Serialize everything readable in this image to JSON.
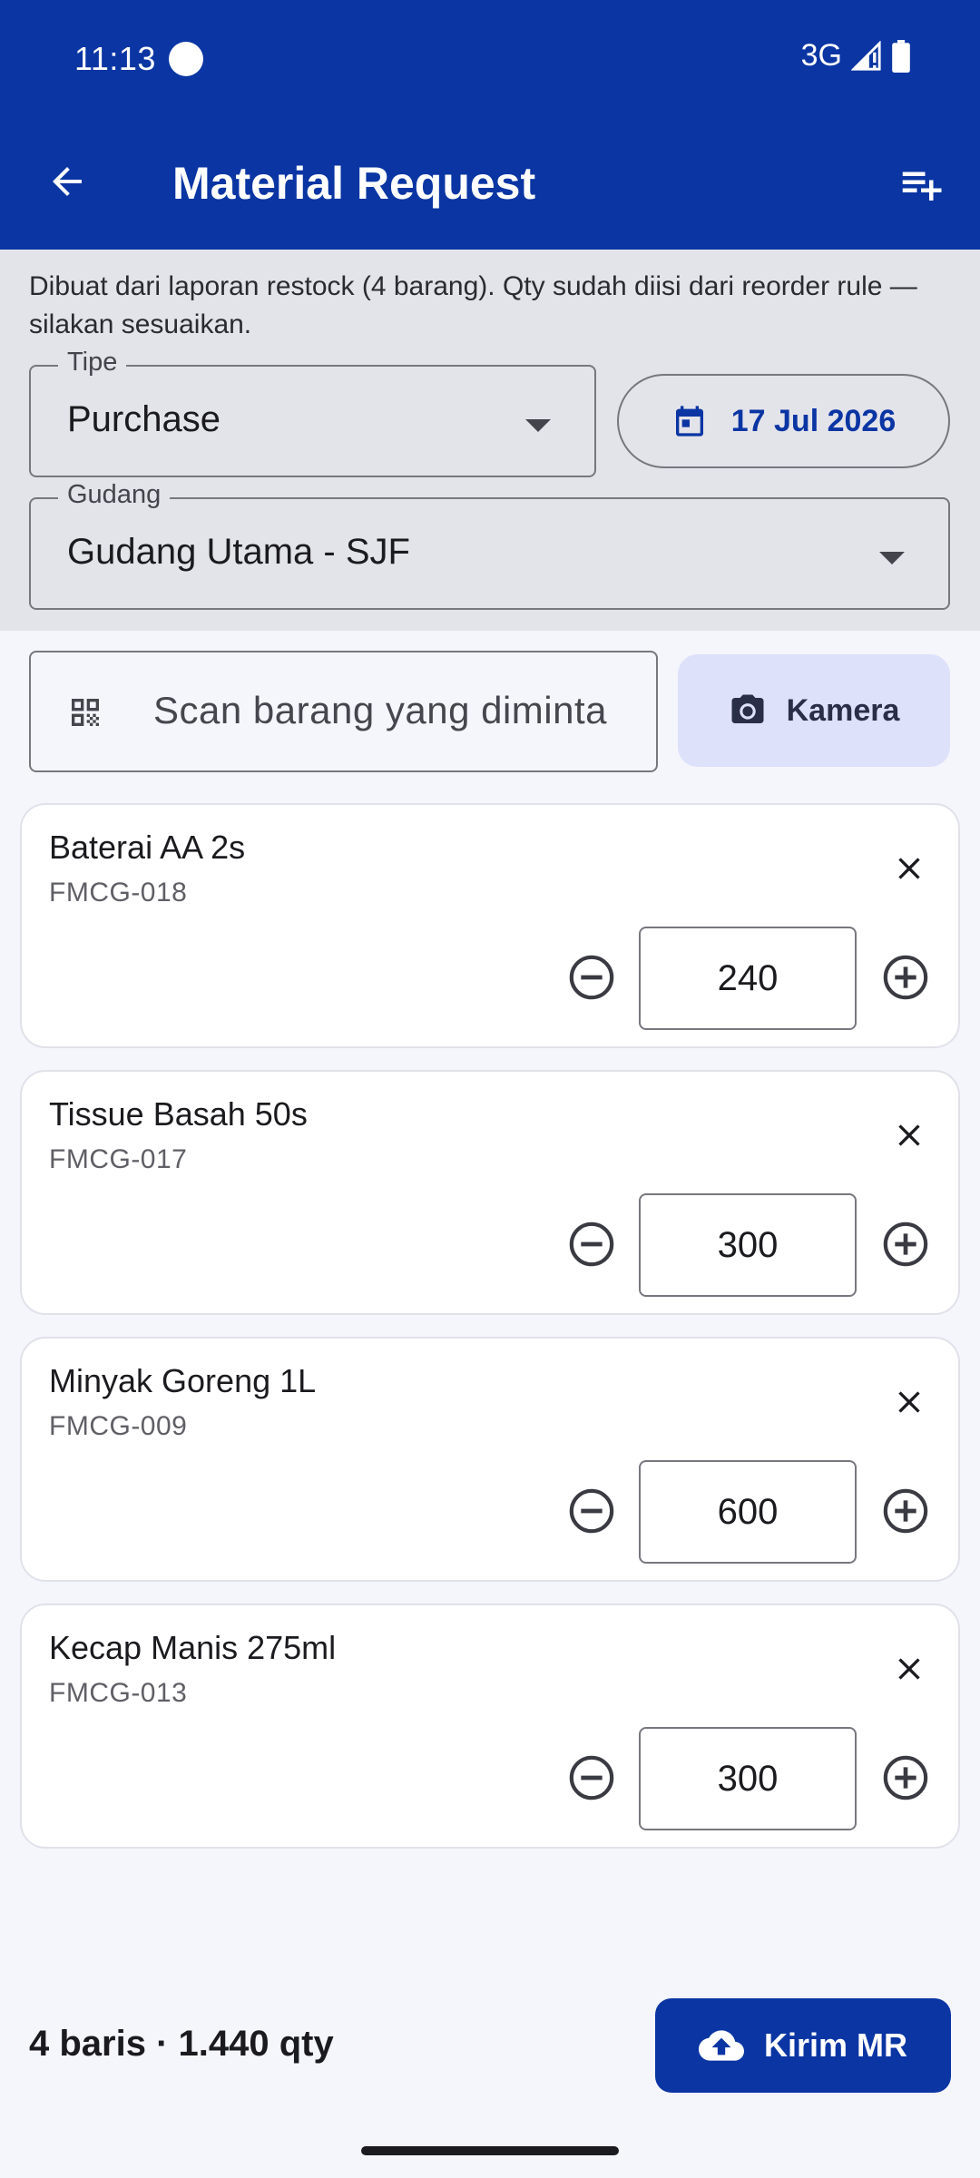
{
  "status_bar": {
    "time": "11:13",
    "network": "3G"
  },
  "app_bar": {
    "title": "Material Request",
    "back_icon": "arrow-left-icon",
    "action_icon": "playlist-add-icon"
  },
  "form": {
    "info_text": "Dibuat dari laporan restock (4 barang). Qty sudah diisi dari reorder rule — silakan sesuaikan.",
    "type_label": "Tipe",
    "type_value": "Purchase",
    "date": "17 Jul 2026",
    "warehouse_label": "Gudang",
    "warehouse_value": "Gudang Utama - SJF"
  },
  "scan": {
    "placeholder": "Scan barang yang diminta",
    "camera_label": "Kamera"
  },
  "items": [
    {
      "name": "Baterai AA 2s",
      "code": "FMCG-018",
      "qty": "240"
    },
    {
      "name": "Tissue Basah 50s",
      "code": "FMCG-017",
      "qty": "300"
    },
    {
      "name": "Minyak Goreng 1L",
      "code": "FMCG-009",
      "qty": "600"
    },
    {
      "name": "Kecap Manis 275ml",
      "code": "FMCG-013",
      "qty": "300"
    }
  ],
  "footer": {
    "summary": "4 baris · 1.440 qty",
    "submit_label": "Kirim MR"
  },
  "colors": {
    "primary": "#0A35A3",
    "tonal_button": "#DDE1F9",
    "panel": "#E3E3EA",
    "background": "#F5F5FC"
  }
}
